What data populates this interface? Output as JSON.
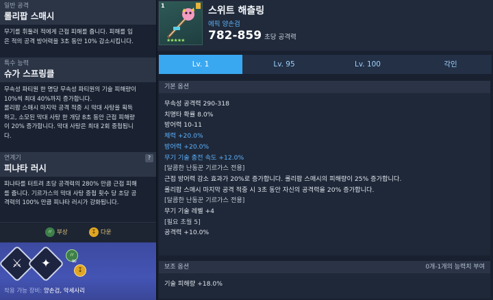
{
  "left": {
    "general": {
      "category": "일반 공격",
      "title": "롤리팝 스매시",
      "desc": [
        "무기를 휘둘러 적에게 근접 피해를 줍니다. 피해를 입",
        "은 적의 공격 방어력을 3초 동안 10% 감소시킵니다."
      ]
    },
    "special": {
      "category": "특수 능력",
      "title": "슈가 스프링클",
      "desc": [
        "무속성 파티원 한 명당 무속성 파티원의 기술 피해량이",
        "10%씩 최대 40%까지 증가합니다.",
        "롤리팝 스매시 마지막 공격 적중 시 막대 사탕을 획득",
        "하고, 소모된 막대 사탕 한 개당 8초 동안 근접 피해량",
        "이 20% 증가합니다. 막대 사탕은 최대 2회 중첩됩니",
        "다."
      ]
    },
    "chain": {
      "category": "연계기",
      "help": "?",
      "title": "피냐타 러시",
      "desc": [
        "피냐타를 터트려 초당 공격력의 280% 만큼 근접 피해",
        "를 줍니다. 기르가스의 막대 사탕 중첩 횟수 당 초당 공",
        "격력의 100% 만큼 피냐타 러시가 강화됩니다."
      ]
    },
    "tags": [
      {
        "icon": "injury-icon",
        "label": "부상",
        "color": "#3e7f4a"
      },
      {
        "icon": "down-icon",
        "label": "다운",
        "color": "#e0a524"
      }
    ],
    "skills": [
      {
        "icon": "sword-icon"
      },
      {
        "icon": "sparkle-icon"
      }
    ],
    "equip_label": "착용 가능 장비:",
    "equip_value": "양손검, 악세사리"
  },
  "weapon": {
    "level_badge": "1",
    "stars": "★★★★★",
    "name": "스위트 해츨링",
    "type": "에픽 양손검",
    "damage": "782-859",
    "damage_label": "초당 공격력"
  },
  "tabs": [
    {
      "label": "Lv. 1",
      "active": true
    },
    {
      "label": "Lv. 95",
      "active": false
    },
    {
      "label": "Lv. 100",
      "active": false
    },
    {
      "label": "각인",
      "active": false
    }
  ],
  "base_options": {
    "header": "기본 옵션",
    "lines": [
      {
        "text": "무속성 공격력  290-318",
        "style": ""
      },
      {
        "text": "치명타 확률  8.0%",
        "style": ""
      },
      {
        "text": "방어력  10-11",
        "style": ""
      },
      {
        "text": "체력  +20.0%",
        "style": "blue"
      },
      {
        "text": "방어력  +20.0%",
        "style": "blue"
      },
      {
        "text": "무기 기술 충전 속도  +12.0%",
        "style": "blue"
      },
      {
        "text": "[달콤한 난동꾼 기르가스 전용]",
        "style": "dim"
      },
      {
        "text": "근접 방어력 감소 효과가 20%로 증가합니다. 롤리팝 스매시의 피해량이 25% 증가합니다.",
        "style": ""
      },
      {
        "text": "롤리팝 스매시 마지막 공격 적중 시 3초 동안 자신의 공격력을 20% 증가합니다.",
        "style": ""
      },
      {
        "text": "[달콤한 난동꾼 기르가스 전용]",
        "style": "dim"
      },
      {
        "text": "무기 기술 레벨 +4",
        "style": ""
      },
      {
        "text": "[필요 초월 5]",
        "style": "dim"
      },
      {
        "text": "공격력 +10.0%",
        "style": ""
      }
    ]
  },
  "sub_options": {
    "header": "보조 옵션",
    "note": "0개-1개의 능력치 부여",
    "lines": [
      {
        "text": "기술 피해량  +18.0%",
        "style": ""
      }
    ]
  }
}
